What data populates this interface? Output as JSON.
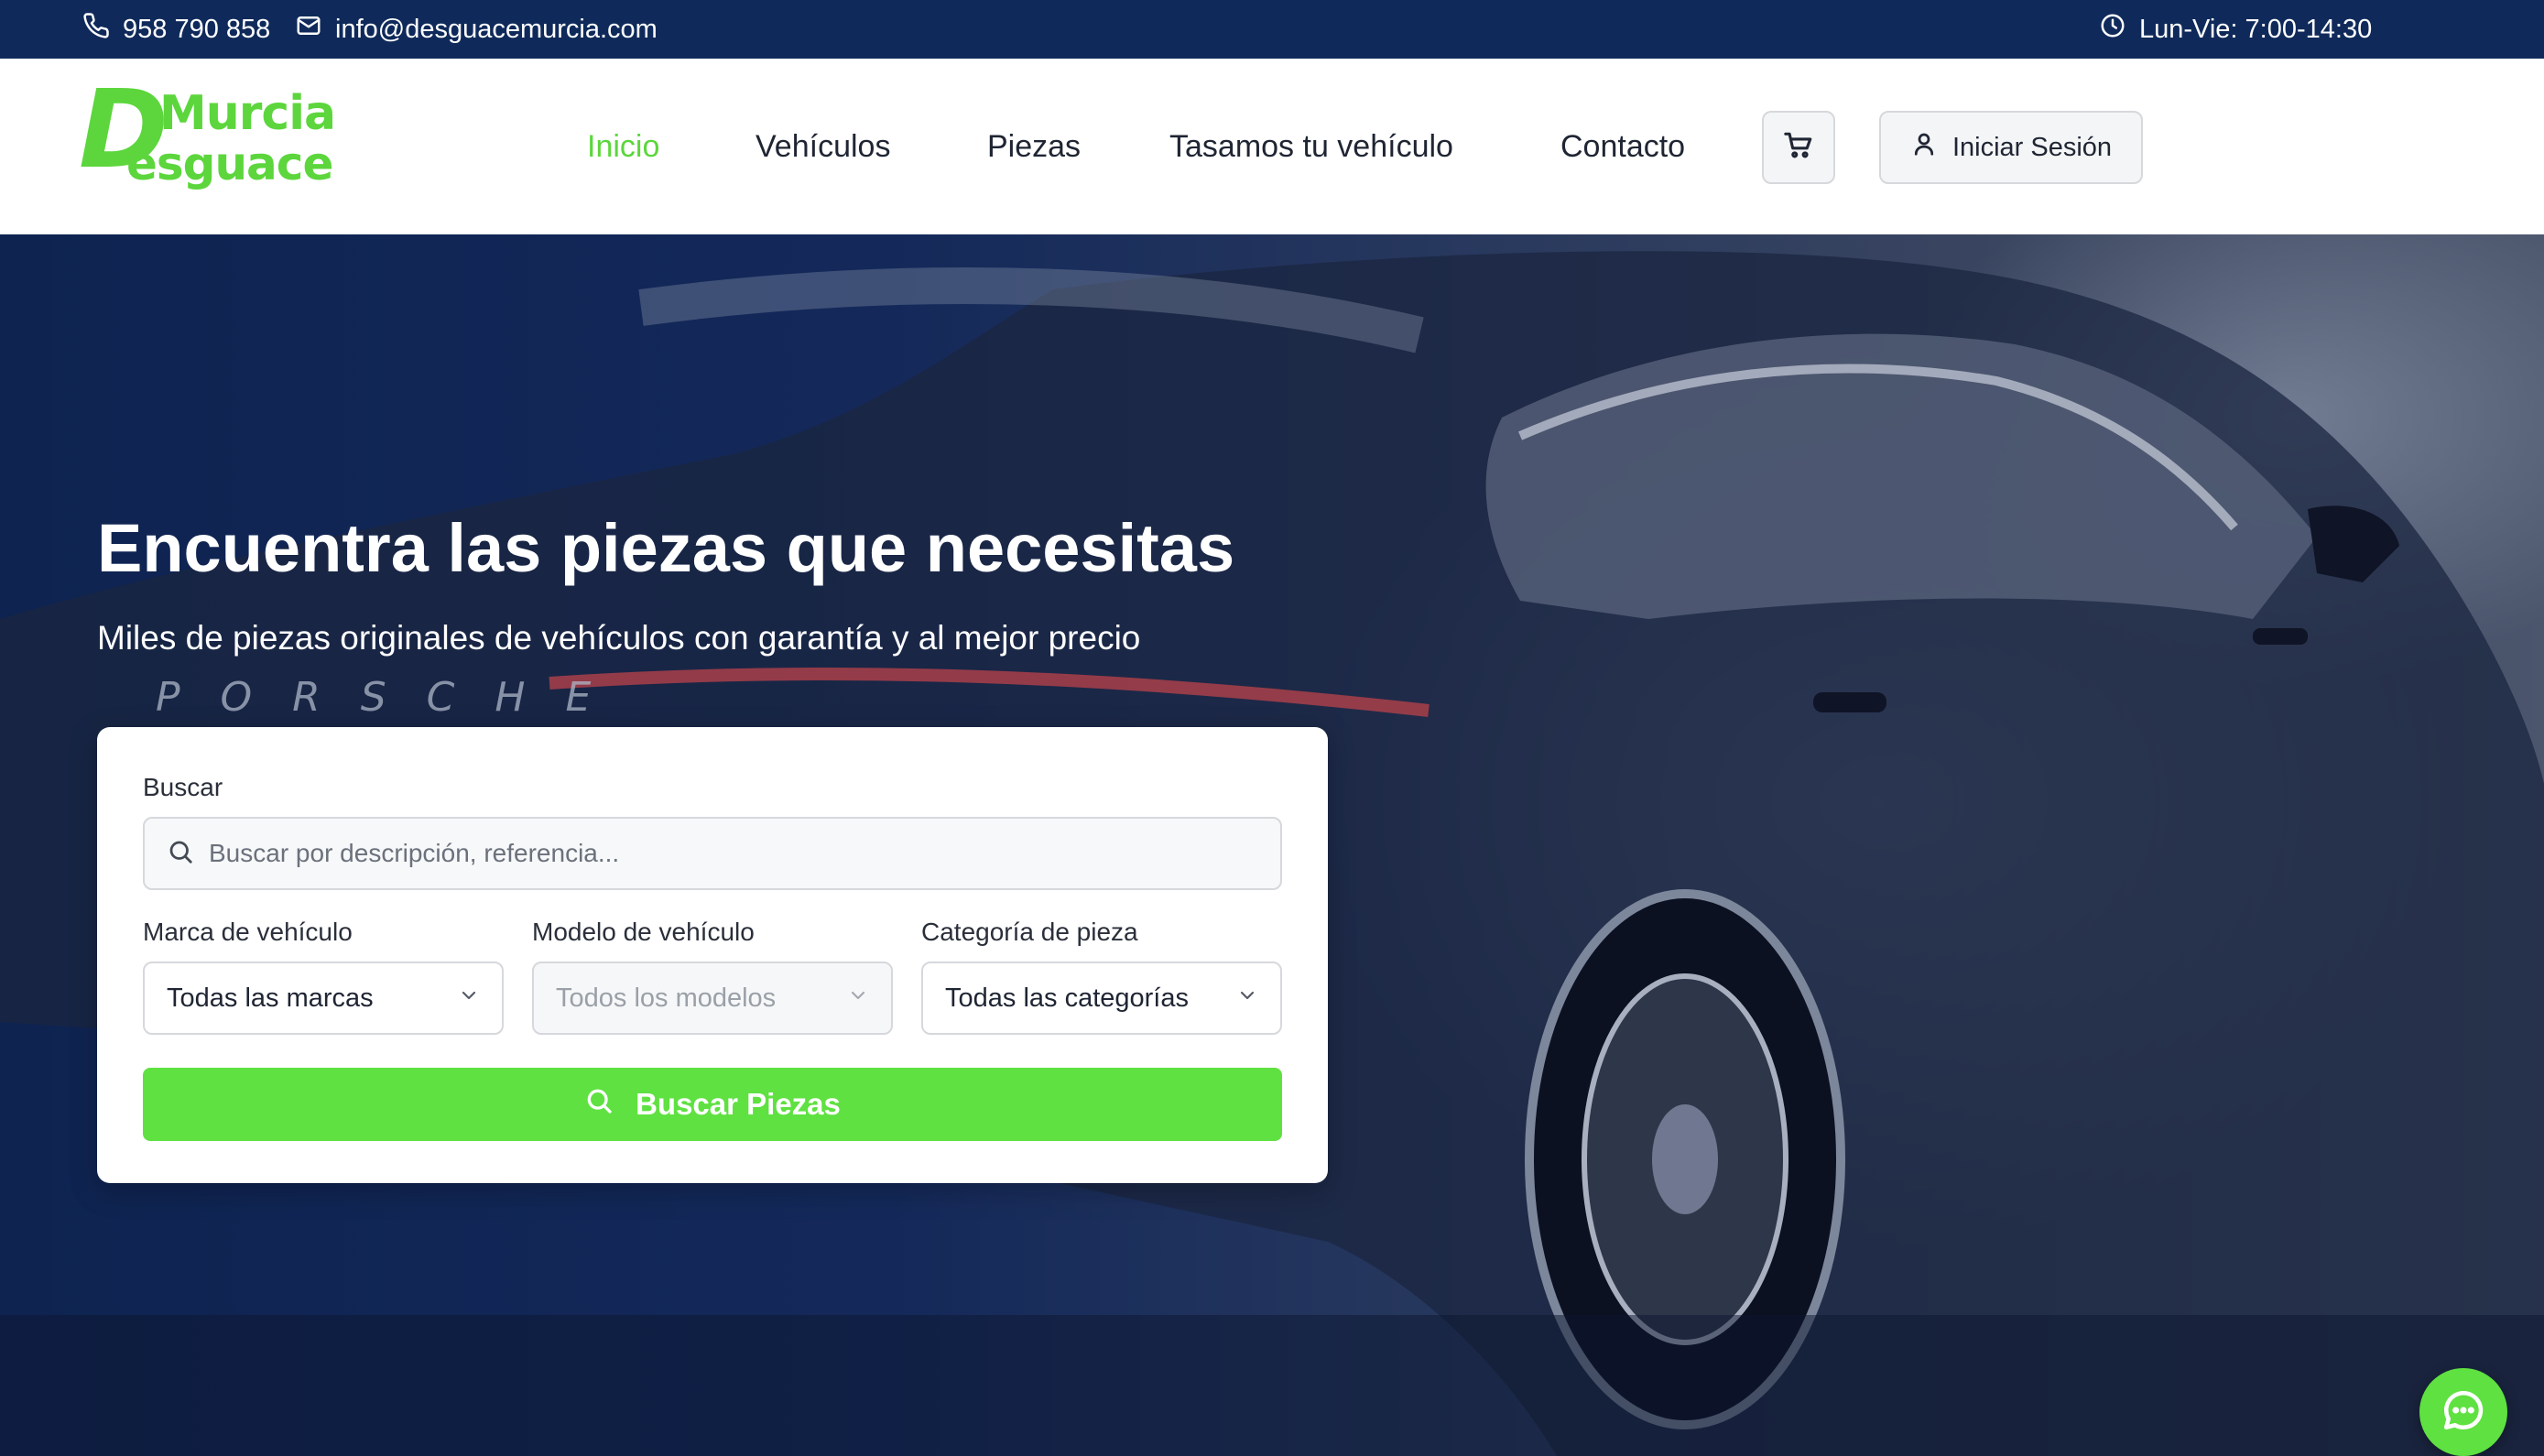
{
  "topbar": {
    "phone": "958 790 858",
    "email": "info@desguacemurcia.com",
    "hours": "Lun-Vie: 7:00-14:30"
  },
  "logo": {
    "letter": "D",
    "line1": "Murcia",
    "line2": "esguace"
  },
  "nav": {
    "items": [
      {
        "label": "Inicio",
        "active": true
      },
      {
        "label": "Vehículos"
      },
      {
        "label": "Piezas"
      },
      {
        "label": "Tasamos tu vehículo"
      },
      {
        "label": "Contacto"
      }
    ],
    "login_label": "Iniciar Sesión"
  },
  "hero": {
    "title": "Encuentra las piezas que necesitas",
    "subtitle": "Miles de piezas originales de vehículos con garantía y al mejor precio",
    "car_brand_lettering": "PORSCHE"
  },
  "search": {
    "label": "Buscar",
    "placeholder": "Buscar por descripción, referencia...",
    "brand_label": "Marca de vehículo",
    "brand_value": "Todas las marcas",
    "model_label": "Modelo de vehículo",
    "model_value": "Todos los modelos",
    "category_label": "Categoría de pieza",
    "category_value": "Todas las categorías",
    "submit_label": "Buscar Piezas"
  },
  "icons": {
    "phone": "phone-icon",
    "email": "mail-icon",
    "hours": "clock-icon",
    "cart": "cart-icon",
    "user": "user-icon",
    "search": "search-icon",
    "chevron": "chevron-down-icon",
    "chat": "chat-icon"
  },
  "colors": {
    "topbar_bg": "#0f2a5a",
    "accent_green": "#5fe141",
    "nav_active": "#5cd63c"
  }
}
